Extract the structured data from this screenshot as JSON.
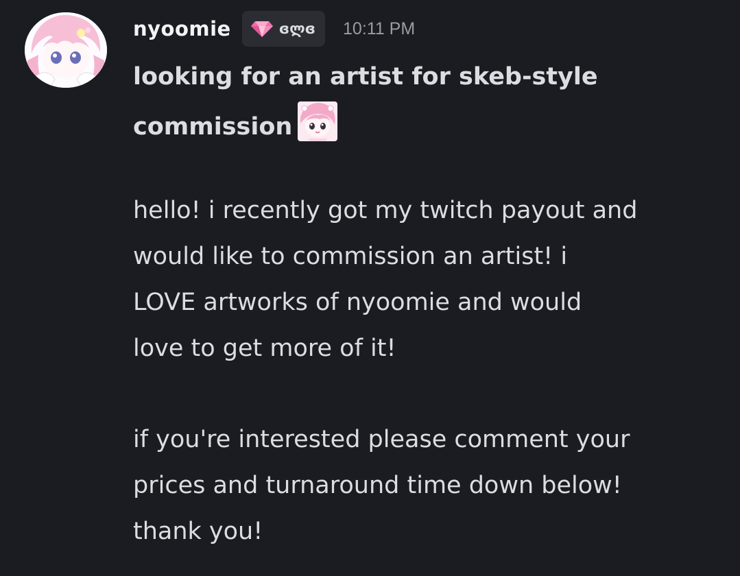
{
  "message": {
    "author": {
      "username": "nyoomie",
      "tag": {
        "icon": "pink-gem-icon",
        "text": "ɞლɞ"
      },
      "avatar": "anime-girl-avatar"
    },
    "timestamp": "10:11 PM",
    "heading": "looking for an artist for skeb-style commission",
    "heading_emoji": "pink-haired-chibi-emoji",
    "paragraphs": [
      "hello! i recently got my twitch payout and\nwould like to commission an artist! i\nLOVE artworks of nyoomie and would\nlove to get more of it!",
      "if you're interested please comment your\nprices and turnaround time down below!\nthank you!"
    ]
  },
  "colors": {
    "background": "#1b1c21",
    "username": "#f2f3f5",
    "text": "#dbdee1",
    "timestamp": "#9a9ca5",
    "tag_background": "#2c2d33",
    "gem": "#f06ea9"
  }
}
